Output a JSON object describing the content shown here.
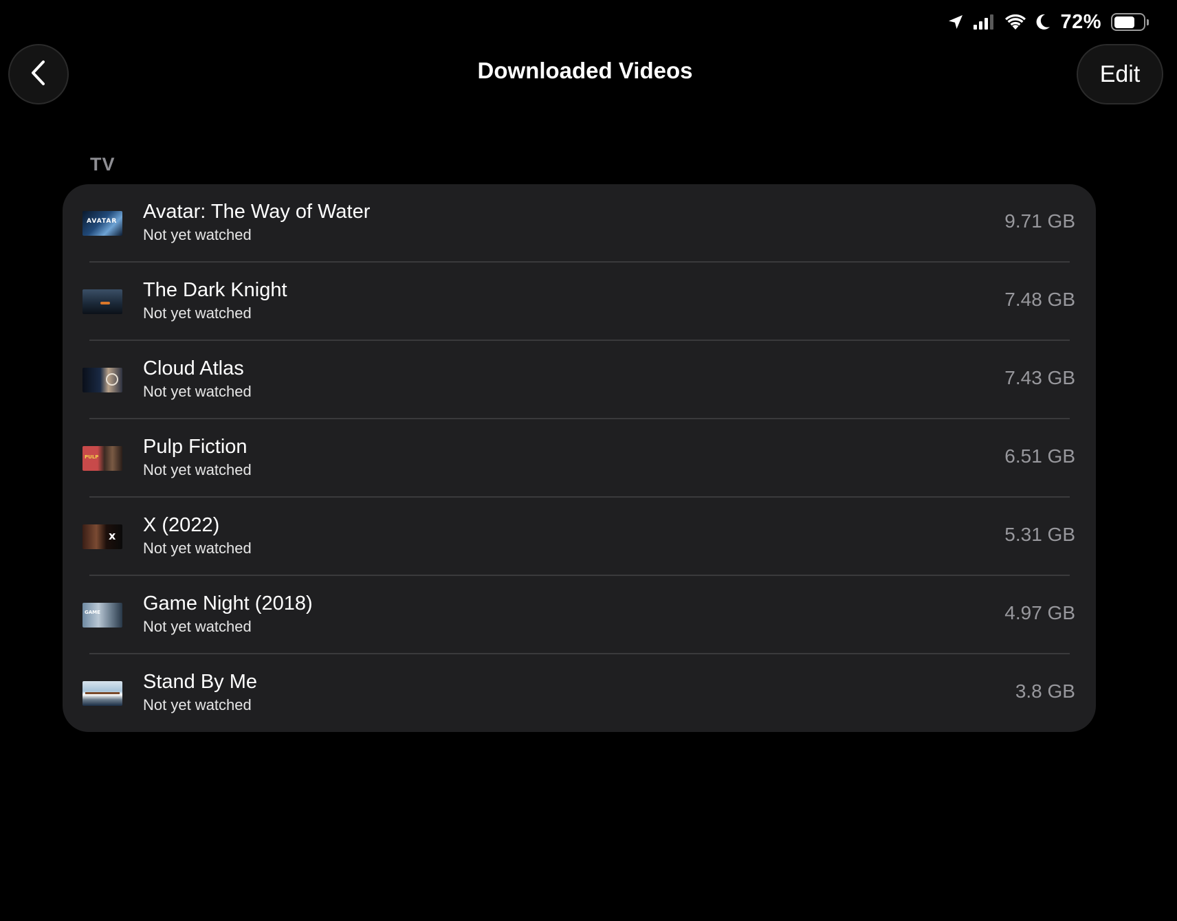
{
  "status_bar": {
    "battery_percent": "72%",
    "battery_level": 0.72,
    "icons": [
      "location-arrow-icon",
      "cellular-signal-icon",
      "wifi-icon",
      "do-not-disturb-moon-icon",
      "battery-icon"
    ]
  },
  "nav": {
    "back_icon": "chevron-left-icon",
    "title": "Downloaded Videos",
    "edit_label": "Edit"
  },
  "section": {
    "header": "TV",
    "items": [
      {
        "title": "Avatar: The Way of Water",
        "status": "Not yet watched",
        "size": "9.71 GB",
        "thumb": "avatar-thumbnail"
      },
      {
        "title": "The Dark Knight",
        "status": "Not yet watched",
        "size": "7.48 GB",
        "thumb": "dark-knight-thumbnail"
      },
      {
        "title": "Cloud Atlas",
        "status": "Not yet watched",
        "size": "7.43 GB",
        "thumb": "cloud-atlas-thumbnail"
      },
      {
        "title": "Pulp Fiction",
        "status": "Not yet watched",
        "size": "6.51 GB",
        "thumb": "pulp-fiction-thumbnail"
      },
      {
        "title": "X (2022)",
        "status": "Not yet watched",
        "size": "5.31 GB",
        "thumb": "x-2022-thumbnail"
      },
      {
        "title": "Game Night (2018)",
        "status": "Not yet watched",
        "size": "4.97 GB",
        "thumb": "game-night-thumbnail"
      },
      {
        "title": "Stand By Me",
        "status": "Not yet watched",
        "size": "3.8 GB",
        "thumb": "stand-by-me-thumbnail"
      }
    ]
  },
  "colors": {
    "background": "#000000",
    "card": "#1f1f21",
    "separator": "#3a3a3c",
    "secondary_text": "#98989d",
    "section_header": "#8e8e93"
  }
}
